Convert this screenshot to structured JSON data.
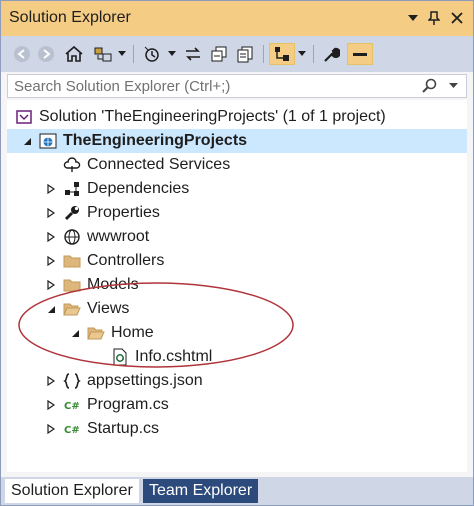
{
  "window": {
    "title": "Solution Explorer",
    "icons": [
      "dropdown-arrow-icon",
      "pin-icon",
      "close-icon"
    ]
  },
  "toolbar": {
    "buttons": [
      "back-icon",
      "forward-icon",
      "home-icon",
      "switch-views-icon",
      "dropdown-icon",
      "pending-changes-filter-icon",
      "dropdown-icon",
      "sync-icon",
      "collapse-all-icon",
      "show-all-files-icon",
      "preview-selected-icon",
      "dropdown-icon",
      "properties-icon",
      "auto-hide-icon"
    ]
  },
  "search": {
    "placeholder": "Search Solution Explorer (Ctrl+;)"
  },
  "tree": {
    "items": [
      {
        "label": "Solution 'TheEngineeringProjects' (1 of 1 project)",
        "icon": "solution-icon",
        "expander": "none",
        "depth": 0
      },
      {
        "label": "TheEngineeringProjects",
        "icon": "web-project-icon",
        "expander": "expanded",
        "depth": 1,
        "selected": true
      },
      {
        "label": "Connected Services",
        "icon": "connected-services-icon",
        "expander": "none",
        "depth": 2
      },
      {
        "label": "Dependencies",
        "icon": "dependencies-icon",
        "expander": "collapsed",
        "depth": 2
      },
      {
        "label": "Properties",
        "icon": "wrench-icon",
        "expander": "collapsed",
        "depth": 2
      },
      {
        "label": "wwwroot",
        "icon": "globe-icon",
        "expander": "collapsed",
        "depth": 2
      },
      {
        "label": "Controllers",
        "icon": "folder-icon",
        "expander": "collapsed",
        "depth": 2
      },
      {
        "label": "Models",
        "icon": "folder-icon",
        "expander": "collapsed",
        "depth": 2
      },
      {
        "label": "Views",
        "icon": "folder-open-icon",
        "expander": "expanded",
        "depth": 2
      },
      {
        "label": "Home",
        "icon": "folder-open-icon",
        "expander": "expanded",
        "depth": 3
      },
      {
        "label": "Info.cshtml",
        "icon": "razor-file-icon",
        "expander": "none",
        "depth": 4
      },
      {
        "label": "appsettings.json",
        "icon": "json-file-icon",
        "expander": "collapsed",
        "depth": 2
      },
      {
        "label": "Program.cs",
        "icon": "csharp-file-icon",
        "expander": "collapsed",
        "depth": 2
      },
      {
        "label": "Startup.cs",
        "icon": "csharp-file-icon",
        "expander": "collapsed",
        "depth": 2
      }
    ]
  },
  "tabs": [
    {
      "label": "Solution Explorer",
      "active": true
    },
    {
      "label": "Team Explorer",
      "active": false
    }
  ],
  "colors": {
    "title_bar": "#f5cc84",
    "toolbar": "#cfd6e5",
    "selection": "#cce8ff",
    "annotation": "#b0343a",
    "inactive_tab": "#2d4a7c"
  }
}
